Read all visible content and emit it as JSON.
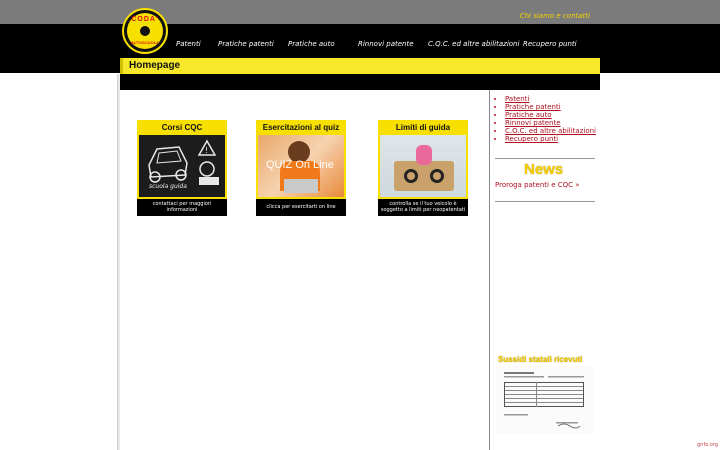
{
  "header": {
    "contact_link": "Chi siamo e contatti",
    "logo_text": "CODA'",
    "logo_subtext": "AUTOSCUOLA"
  },
  "nav": {
    "items": [
      {
        "label": "Patenti"
      },
      {
        "label": "Pratiche patenti"
      },
      {
        "label": "Pratiche auto"
      },
      {
        "label": "Rinnovi patente"
      },
      {
        "label": "C.Q.C. ed altre abilitazioni"
      },
      {
        "label": "Recupero punti"
      }
    ]
  },
  "page": {
    "title": "Homepage"
  },
  "cards": [
    {
      "title": "Corsi CQC",
      "caption": "contattaci per maggiori informazioni",
      "image_text": "scuola guida"
    },
    {
      "title": "Esercitazioni al quiz",
      "caption": "clicca per esercitarti on line",
      "image_text": "QUIZ On Line"
    },
    {
      "title": "Limiti di guida",
      "caption": "controlla se il tuo veicolo è soggetto a limiti per neopatentati"
    }
  ],
  "sidebar": {
    "links": [
      {
        "label": "Patenti"
      },
      {
        "label": "Pratiche patenti"
      },
      {
        "label": "Pratiche auto"
      },
      {
        "label": "Rinnovi patente"
      },
      {
        "label": "C.O.C. ed altre abilitazioni"
      },
      {
        "label": "Recupero punti"
      }
    ],
    "news_title": "News",
    "news_link": "Proroga patenti e CQC »",
    "subsidi_title": "Sussidi statali ricevuti"
  },
  "footer": {
    "credit": "gnfo.org"
  },
  "colors": {
    "accent_yellow": "#f7e000",
    "link_red": "#b01020",
    "nav_black": "#000000",
    "topbar_gray": "#7b7b7b"
  }
}
